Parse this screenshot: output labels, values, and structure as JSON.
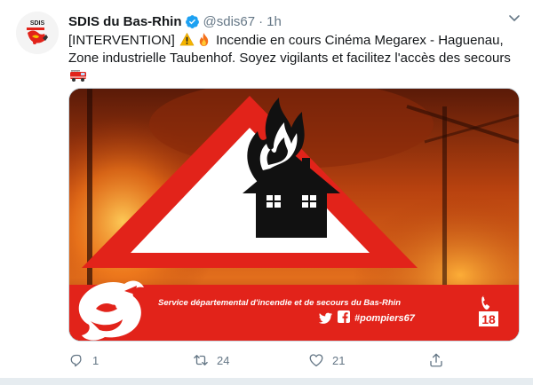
{
  "tweet": {
    "author_name": "SDIS du Bas-Rhin",
    "handle": "@sdis67",
    "separator": "·",
    "time": "1h",
    "text_prefix": "[INTERVENTION]",
    "text_line1_rest": "Incendie en cours Cinéma Megarex - Haguenau,",
    "text_line2": "Zone industrielle Taubenhof. Soyez vigilants et facilitez l'accès des secours",
    "emojis": [
      "warning-icon",
      "fire-icon",
      "fire-engine-icon"
    ]
  },
  "media": {
    "banner_title": "Service départemental d'incendie et de secours du Bas-Rhin",
    "social_tag": "#pompiers67",
    "emergency_number": "18",
    "colors": {
      "banner_red": "#e2231a",
      "triangle_red": "#e2231a"
    }
  },
  "avatar": {
    "label": "SDIS"
  },
  "actions": {
    "reply_count": "1",
    "retweet_count": "24",
    "like_count": "21"
  },
  "colors": {
    "verified_blue": "#1da1f2",
    "muted": "#657786"
  }
}
